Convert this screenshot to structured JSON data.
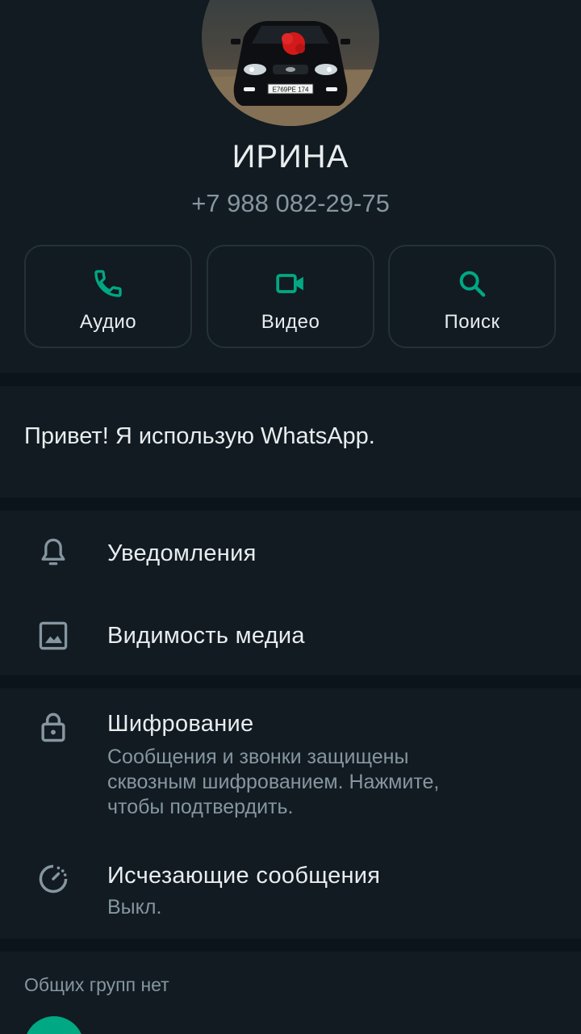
{
  "contact": {
    "name": "ИРИНА",
    "phone": "+7 988 082-29-75",
    "plate": "E769PE 174"
  },
  "actions": [
    {
      "label": "Аудио",
      "icon": "phone-icon"
    },
    {
      "label": "Видео",
      "icon": "video-camera-icon"
    },
    {
      "label": "Поиск",
      "icon": "search-icon"
    }
  ],
  "about": {
    "text": "Привет! Я использую WhatsApp."
  },
  "settings": {
    "notifications": {
      "title": "Уведомления",
      "icon": "bell-icon"
    },
    "media_visibility": {
      "title": "Видимость медиа",
      "icon": "image-icon"
    },
    "encryption": {
      "title": "Шифрование",
      "subtitle_lines": [
        "Сообщения и звонки защищены",
        "сквозным шифрованием. Нажмите,",
        "чтобы подтвердить."
      ],
      "icon": "lock-icon"
    },
    "disappearing": {
      "title": "Исчезающие сообщения",
      "subtitle": "Выкл.",
      "icon": "timer-icon"
    }
  },
  "groups": {
    "title": "Общих групп нет"
  },
  "colors": {
    "accent": "#00a884",
    "background": "#0b141a",
    "panel": "#111b21",
    "secondary_text": "#8696a0"
  }
}
